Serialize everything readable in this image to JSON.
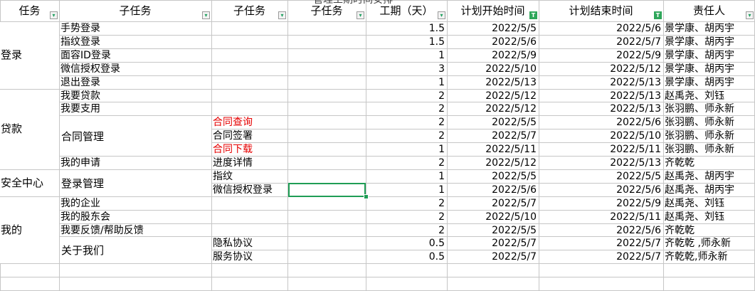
{
  "sheet": {
    "title_fragment": "管理工期时间安排",
    "headers": [
      {
        "label": "任务",
        "filter": "normal"
      },
      {
        "label": "子任务",
        "filter": "normal"
      },
      {
        "label": "子任务",
        "filter": "normal"
      },
      {
        "label": "子任务",
        "filter": "normal"
      },
      {
        "label": "工期（天）",
        "filter": "normal"
      },
      {
        "label": "计划开始时间",
        "filter": "active"
      },
      {
        "label": "计划结束时间",
        "filter": "active"
      },
      {
        "label": "责任人",
        "filter": "normal"
      }
    ],
    "groups": [
      {
        "label": "登录",
        "start": 0,
        "span": 5
      },
      {
        "label": "贷款",
        "start": 5,
        "span": 6
      },
      {
        "label": "安全中心",
        "start": 11,
        "span": 2
      },
      {
        "label": "我的",
        "start": 13,
        "span": 5
      }
    ],
    "sub_merged": [
      {
        "label": "合同管理",
        "start": 7,
        "span": 3
      },
      {
        "label": "登录管理",
        "start": 11,
        "span": 2
      },
      {
        "label": "关于我们",
        "start": 16,
        "span": 2
      }
    ],
    "rows": [
      {
        "sub1": "手势登录",
        "sub2": "",
        "days": "1.5",
        "start": "2022/5/5",
        "end": "2022/5/6",
        "owner": "景学康、胡丙宇"
      },
      {
        "sub1": "指纹登录",
        "sub2": "",
        "days": "1.5",
        "start": "2022/5/6",
        "end": "2022/5/7",
        "owner": "景学康、胡丙宇"
      },
      {
        "sub1": "面容ID登录",
        "sub2": "",
        "days": "1",
        "start": "2022/5/9",
        "end": "2022/5/9",
        "owner": "景学康、胡丙宇"
      },
      {
        "sub1": "微信授权登录",
        "sub2": "",
        "days": "3",
        "start": "2022/5/10",
        "end": "2022/5/12",
        "owner": "景学康、胡丙宇"
      },
      {
        "sub1": "退出登录",
        "sub2": "",
        "days": "1",
        "start": "2022/5/13",
        "end": "2022/5/13",
        "owner": "景学康、胡丙宇"
      },
      {
        "sub1": "我要贷款",
        "sub2": "",
        "days": "2",
        "start": "2022/5/12",
        "end": "2022/5/13",
        "owner": "赵禹尧、刘钰"
      },
      {
        "sub1": "我要支用",
        "sub2": "",
        "days": "2",
        "start": "2022/5/12",
        "end": "2022/5/13",
        "owner": "张羽鹏、师永新"
      },
      {
        "sub1": "",
        "sub2": "合同查询",
        "sub2_red": true,
        "days": "2",
        "start": "2022/5/5",
        "end": "2022/5/6",
        "owner": "张羽鹏、师永新"
      },
      {
        "sub1": "",
        "sub2": "合同签署",
        "days": "2",
        "start": "2022/5/7",
        "end": "2022/5/10",
        "owner": "张羽鹏、师永新"
      },
      {
        "sub1": "",
        "sub2": "合同下载",
        "sub2_red": true,
        "days": "1",
        "start": "2022/5/11",
        "end": "2022/5/11",
        "owner": "张羽鹏、师永新"
      },
      {
        "sub1": "我的申请",
        "sub2": "进度详情",
        "days": "2",
        "start": "2022/5/12",
        "end": "2022/5/13",
        "owner": "齐乾乾"
      },
      {
        "sub1": "",
        "sub2": "指纹",
        "days": "1",
        "start": "2022/5/5",
        "end": "2022/5/5",
        "owner": "赵禹尧、胡丙宇"
      },
      {
        "sub1": "",
        "sub2": "微信授权登录",
        "days": "1",
        "start": "2022/5/6",
        "end": "2022/5/6",
        "owner": "赵禹尧、胡丙宇"
      },
      {
        "sub1": "我的企业",
        "sub2": "",
        "days": "2",
        "start": "2022/5/7",
        "end": "2022/5/9",
        "owner": "赵禹尧、刘钰"
      },
      {
        "sub1": "我的股东会",
        "sub2": "",
        "days": "2",
        "start": "2022/5/10",
        "end": "2022/5/11",
        "owner": "赵禹尧、刘钰"
      },
      {
        "sub1": "我要反馈/帮助反馈",
        "sub2": "",
        "days": "2",
        "start": "2022/5/5",
        "end": "2022/5/6",
        "owner": "齐乾乾"
      },
      {
        "sub1": "",
        "sub2": "隐私协议",
        "days": "0.5",
        "start": "2022/5/7",
        "end": "2022/5/7",
        "owner": "齐乾乾 ,师永新"
      },
      {
        "sub1": "",
        "sub2": "服务协议",
        "days": "0.5",
        "start": "2022/5/7",
        "end": "2022/5/7",
        "owner": "齐乾乾,师永新"
      }
    ],
    "colors": {
      "gridline": "#c6c6c6",
      "selection": "#1f9d55",
      "red_text": "#e60000",
      "filter_active": "#2ea65a"
    },
    "icons": {
      "filter": "dropdown-filter-icon",
      "filter_active": "active-filter-icon"
    }
  }
}
